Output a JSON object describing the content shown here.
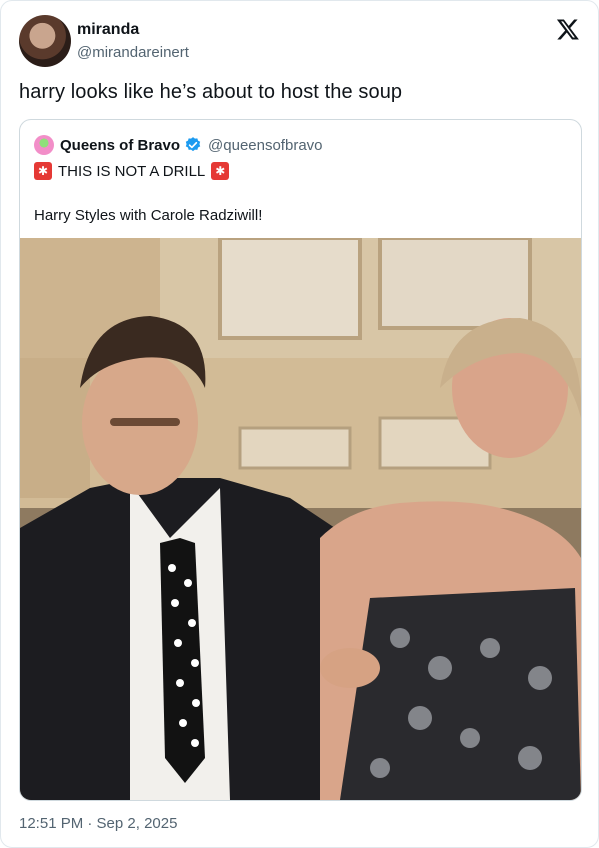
{
  "tweet": {
    "author_name": "miranda",
    "author_handle": "@mirandareinert",
    "text": "harry looks like he’s about to host the soup",
    "timestamp": "12:51 PM · Sep 2, 2025"
  },
  "quoted_tweet": {
    "author_name": "Queens of Bravo",
    "author_handle": "@queensofbravo",
    "verified": true,
    "line1": "THIS IS NOT A DRILL",
    "line2": "Harry Styles with Carole Radziwill!",
    "emoji": "rotating-light-icon"
  },
  "colors": {
    "text_primary": "#0f1419",
    "text_secondary": "#536471",
    "border": "#cfd9de",
    "verified_blue": "#1d9bf0",
    "siren_red": "#e53935"
  }
}
